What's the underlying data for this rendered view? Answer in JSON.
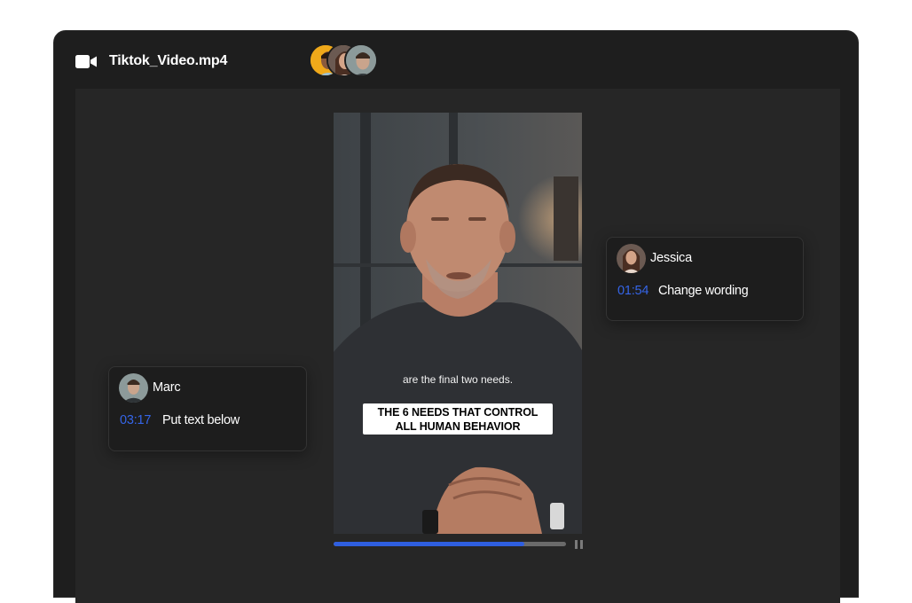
{
  "window": {
    "file_name": "Tiktok_Video.mp4",
    "camera_icon": "video-camera-icon",
    "collaborators": [
      {
        "avatar": "avatar-man-beard"
      },
      {
        "avatar": "avatar-woman"
      },
      {
        "avatar": "avatar-man"
      }
    ]
  },
  "video": {
    "caption_line": "are the final two needs.",
    "title_box_line1": "THE 6 NEEDS THAT CONTROL",
    "title_box_line2": "ALL HUMAN BEHAVIOR",
    "progress_percent": 82,
    "pause_icon": "pause-icon",
    "colors": {
      "progress": "#2f5fe0",
      "track": "#6a6a6a"
    }
  },
  "comments": [
    {
      "name": "Jessica",
      "time": "01:54",
      "text": "Change wording"
    },
    {
      "name": "Marc",
      "time": "03:17",
      "text": "Put text below"
    }
  ],
  "colors": {
    "accent": "#3565e8",
    "panel": "#1e1e1e",
    "stage": "#262626"
  }
}
